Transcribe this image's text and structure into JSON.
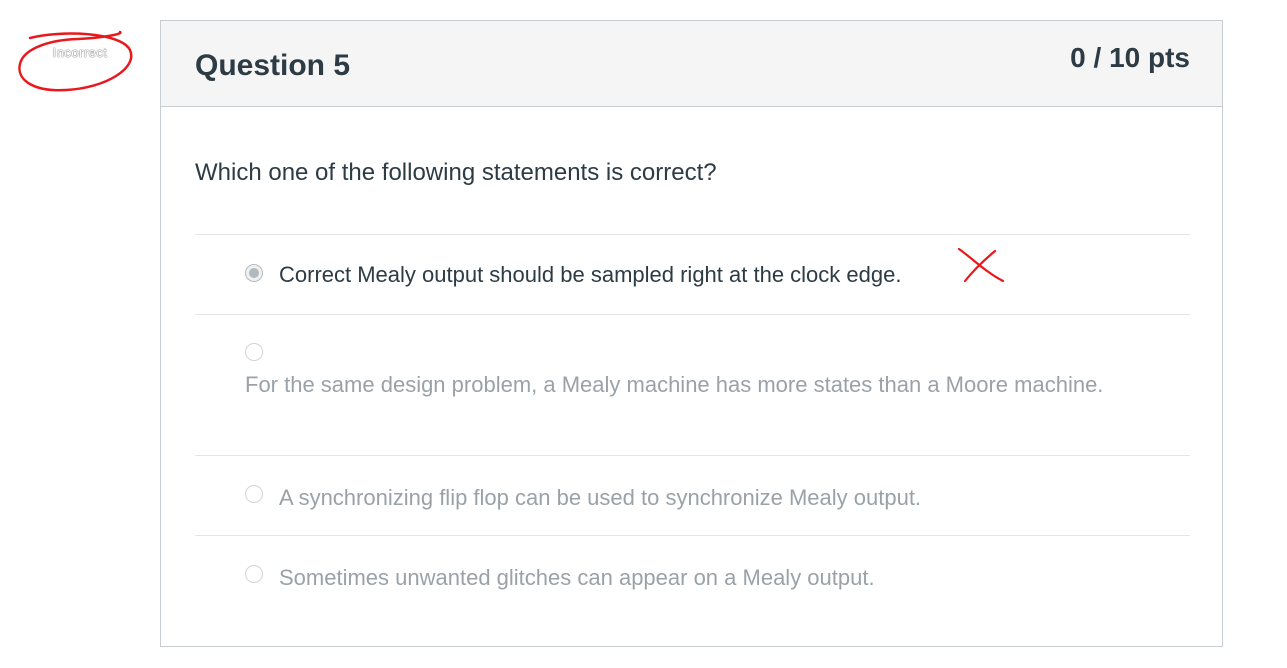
{
  "side_marker": {
    "text": "Incorrect",
    "ring_color": "#e8191c"
  },
  "question": {
    "title": "Question 5",
    "points": "0 / 10 pts",
    "text": "Which one of the following statements is correct?",
    "answers": [
      {
        "label": "Correct Mealy output should be sampled right at the clock edge.",
        "selected": true,
        "marked_wrong": true
      },
      {
        "label": "For the same design problem, a Mealy machine has more states than a Moore machine.",
        "selected": false
      },
      {
        "label": "A synchronizing flip flop can be used to synchronize Mealy output.",
        "selected": false
      },
      {
        "label": "Sometimes unwanted glitches can appear on a Mealy output.",
        "selected": false
      }
    ],
    "wrong_mark_icon": "red-x-icon",
    "wrong_mark_color": "#e8191c"
  }
}
